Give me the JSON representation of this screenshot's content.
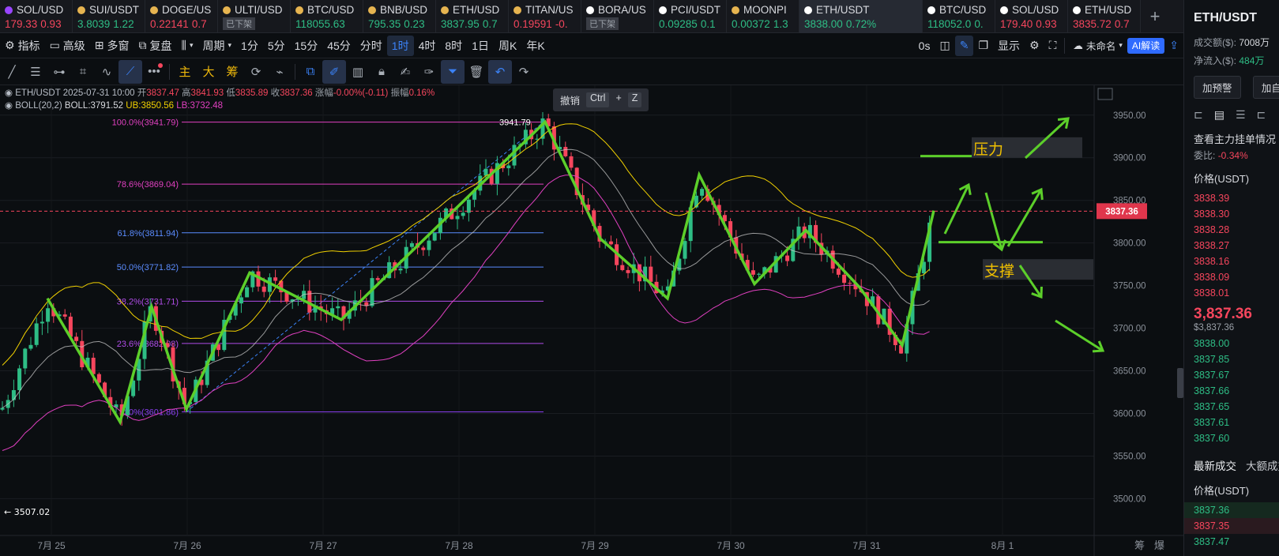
{
  "tabs": [
    {
      "symbol": "SOL/USD",
      "price": "179.33",
      "change": "0.93",
      "dir": "down",
      "icon": "sol-icon",
      "icon_color": "#9945ff"
    },
    {
      "symbol": "SUI/USDT",
      "price": "3.8039",
      "change": "1.22",
      "dir": "up",
      "icon": "sui-icon",
      "icon_color": "#e6b450"
    },
    {
      "symbol": "DOGE/US",
      "price": "0.22141",
      "change": "0.7",
      "dir": "down",
      "icon": "doge-icon",
      "icon_color": "#e6b450"
    },
    {
      "symbol": "ULTI/USD",
      "badge": "已下架",
      "icon": "ulti-icon",
      "icon_color": "#e6b450"
    },
    {
      "symbol": "BTC/USD",
      "price": "118055.63",
      "change": "",
      "dir": "up",
      "icon": "btc-icon",
      "icon_color": "#e6b450"
    },
    {
      "symbol": "BNB/USD",
      "price": "795.35",
      "change": "0.23",
      "dir": "up",
      "icon": "bnb-icon",
      "icon_color": "#e6b450"
    },
    {
      "symbol": "ETH/USD",
      "price": "3837.95",
      "change": "0.7",
      "dir": "up",
      "icon": "eth-icon",
      "icon_color": "#e6b450"
    },
    {
      "symbol": "TITAN/US",
      "price": "0.19591",
      "change": "-0.",
      "dir": "down",
      "icon": "titan-icon",
      "icon_color": "#e6b450"
    },
    {
      "symbol": "BORA/US",
      "badge": "已下架",
      "icon": "bora-icon",
      "icon_color": "#ffffff"
    },
    {
      "symbol": "PCI/USDT",
      "price": "0.09285",
      "change": "0.1",
      "dir": "up",
      "icon": "pci-icon",
      "icon_color": "#ffffff"
    },
    {
      "symbol": "MOONPI",
      "price": "0.00372",
      "change": "1.3",
      "dir": "up",
      "icon": "moonpig-icon",
      "icon_color": "#e6b450"
    },
    {
      "symbol": "ETH/USDT",
      "price": "3838.00",
      "change": "0.72%",
      "dir": "up",
      "icon": "eth-icon",
      "icon_color": "#ffffff",
      "active": true
    },
    {
      "symbol": "BTC/USD",
      "price": "118052.0",
      "change": "0.",
      "dir": "up",
      "icon": "btc-icon",
      "icon_color": "#ffffff"
    },
    {
      "symbol": "SOL/USD",
      "price": "179.40",
      "change": "0.93",
      "dir": "down",
      "icon": "sol-icon",
      "icon_color": "#ffffff"
    },
    {
      "symbol": "ETH/USD",
      "price": "3835.72",
      "change": "0.7",
      "dir": "down",
      "icon": "eth-icon",
      "icon_color": "#ffffff"
    }
  ],
  "toolbar1": {
    "indicators": "指标",
    "advanced": "高级",
    "multiwindow": "多窗",
    "replay": "复盘",
    "period": "周期",
    "intervals": [
      "1分",
      "5分",
      "15分",
      "45分",
      "分时",
      "1时",
      "4时",
      "8时",
      "1日",
      "周K",
      "年K"
    ],
    "selected_interval": "1时",
    "seconds": "0s",
    "display": "显示",
    "unnamed": "未命名",
    "ai": "AI解读"
  },
  "toolbar2": {
    "main": "主",
    "big": "大",
    "chips": "筹"
  },
  "chart_info": {
    "symbol": "ETH/USDT",
    "datetime": "2025-07-31 10:00",
    "open_label": "开",
    "open": "3837.47",
    "high_label": "高",
    "high": "3841.93",
    "low_label": "低",
    "low": "3835.89",
    "close_label": "收",
    "close": "3837.36",
    "change_label": "涨幅",
    "change": "-0.00%(-0.11)",
    "amp_label": "振幅",
    "amp": "0.16%",
    "boll_label": "BOLL(20,2)",
    "boll": "BOLL:3791.52",
    "ub": "UB:3850.56",
    "lb": "LB:3732.48"
  },
  "undo_tip": {
    "label": "撤销",
    "key1": "Ctrl",
    "plus": "+",
    "key2": "Z"
  },
  "chart_data": {
    "type": "candlestick",
    "y_ticks": [
      "3950.00",
      "3900.00",
      "3850.00",
      "3800.00",
      "3750.00",
      "3700.00",
      "3650.00",
      "3600.00",
      "3550.00",
      "3500.00"
    ],
    "ylim": [
      3480,
      3985
    ],
    "x_ticks": [
      "7月 25",
      "7月 26",
      "7月 27",
      "7月 28",
      "7月 29",
      "7月 30",
      "7月 31",
      "8月 1"
    ],
    "current_price": "3837.36",
    "high_marker": "3941.79",
    "low_marker": "← 3507.02",
    "fib_levels": [
      {
        "label": "100.0%(3941.79)",
        "value": 3941.79,
        "color": "#e040c0"
      },
      {
        "label": "78.6%(3869.04)",
        "value": 3869.04,
        "color": "#e040c0"
      },
      {
        "label": "61.8%(3811.94)",
        "value": 3811.94,
        "color": "#5b8cff"
      },
      {
        "label": "50.0%(3771.82)",
        "value": 3771.82,
        "color": "#5b8cff"
      },
      {
        "label": "38.2%(3731.71)",
        "value": 3731.71,
        "color": "#b04ce8"
      },
      {
        "label": "23.6%(3682.08)",
        "value": 3682.08,
        "color": "#b04ce8"
      },
      {
        "label": "0.0%(3601.86)",
        "value": 3601.86,
        "color": "#8a3ff0"
      }
    ],
    "annotations": {
      "resistance": "压力",
      "support": "支撑"
    },
    "bottom_labels": [
      "筹",
      "爆"
    ]
  },
  "right_panel": {
    "title": "ETH/USDT",
    "volume_label": "成交额($):",
    "volume": "7008万",
    "inflow_label": "净流入($):",
    "inflow": "484万",
    "alert_button": "加预警",
    "add_button": "加自选",
    "orderbook_link": "查看主力挂单情况",
    "ratio_label": "委比:",
    "ratio": "-0.34%",
    "price_header": "价格(USDT)",
    "asks": [
      "3838.39",
      "3838.30",
      "3838.28",
      "3838.27",
      "3838.16",
      "3838.09",
      "3838.01"
    ],
    "last_price": "3,837.36",
    "last_price_usd": "$3,837.36",
    "bids": [
      "3838.00",
      "3837.85",
      "3837.67",
      "3837.66",
      "3837.65",
      "3837.61",
      "3837.60"
    ],
    "trades_tab": "最新成交",
    "big_tab": "大额成交",
    "trades_header": "价格(USDT)",
    "trades": [
      {
        "price": "3837.36",
        "dir": "up"
      },
      {
        "price": "3837.35",
        "dir": "down"
      },
      {
        "price": "3837.47",
        "dir": "up"
      }
    ],
    "colors": {
      "up": "#2ebd85",
      "down": "#f6465d"
    }
  }
}
